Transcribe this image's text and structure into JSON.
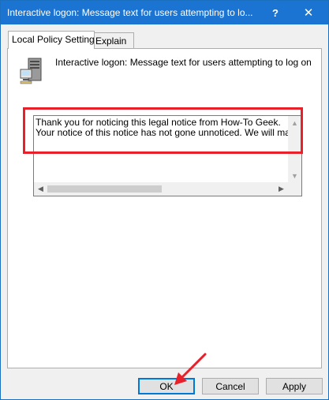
{
  "window": {
    "title": "Interactive logon: Message text for users attempting to lo...",
    "help_glyph": "?",
    "close_glyph": "✕"
  },
  "tabs": [
    {
      "label": "Local Policy Setting",
      "active": true
    },
    {
      "label": "Explain",
      "active": false
    }
  ],
  "policy": {
    "icon": "server-computer-icon",
    "name": "Interactive logon: Message text for users attempting to log on"
  },
  "message_text": "Thank you for noticing this legal notice from How-To Geek.\nYour notice of this notice has not gone unnoticed. We will make not",
  "scrollbars": {
    "up_glyph": "▲",
    "down_glyph": "▼",
    "left_glyph": "◀",
    "right_glyph": "▶"
  },
  "buttons": {
    "ok": "OK",
    "cancel": "Cancel",
    "apply": "Apply"
  },
  "annotation_color": "#e8202a",
  "accent_color": "#1b74d1"
}
